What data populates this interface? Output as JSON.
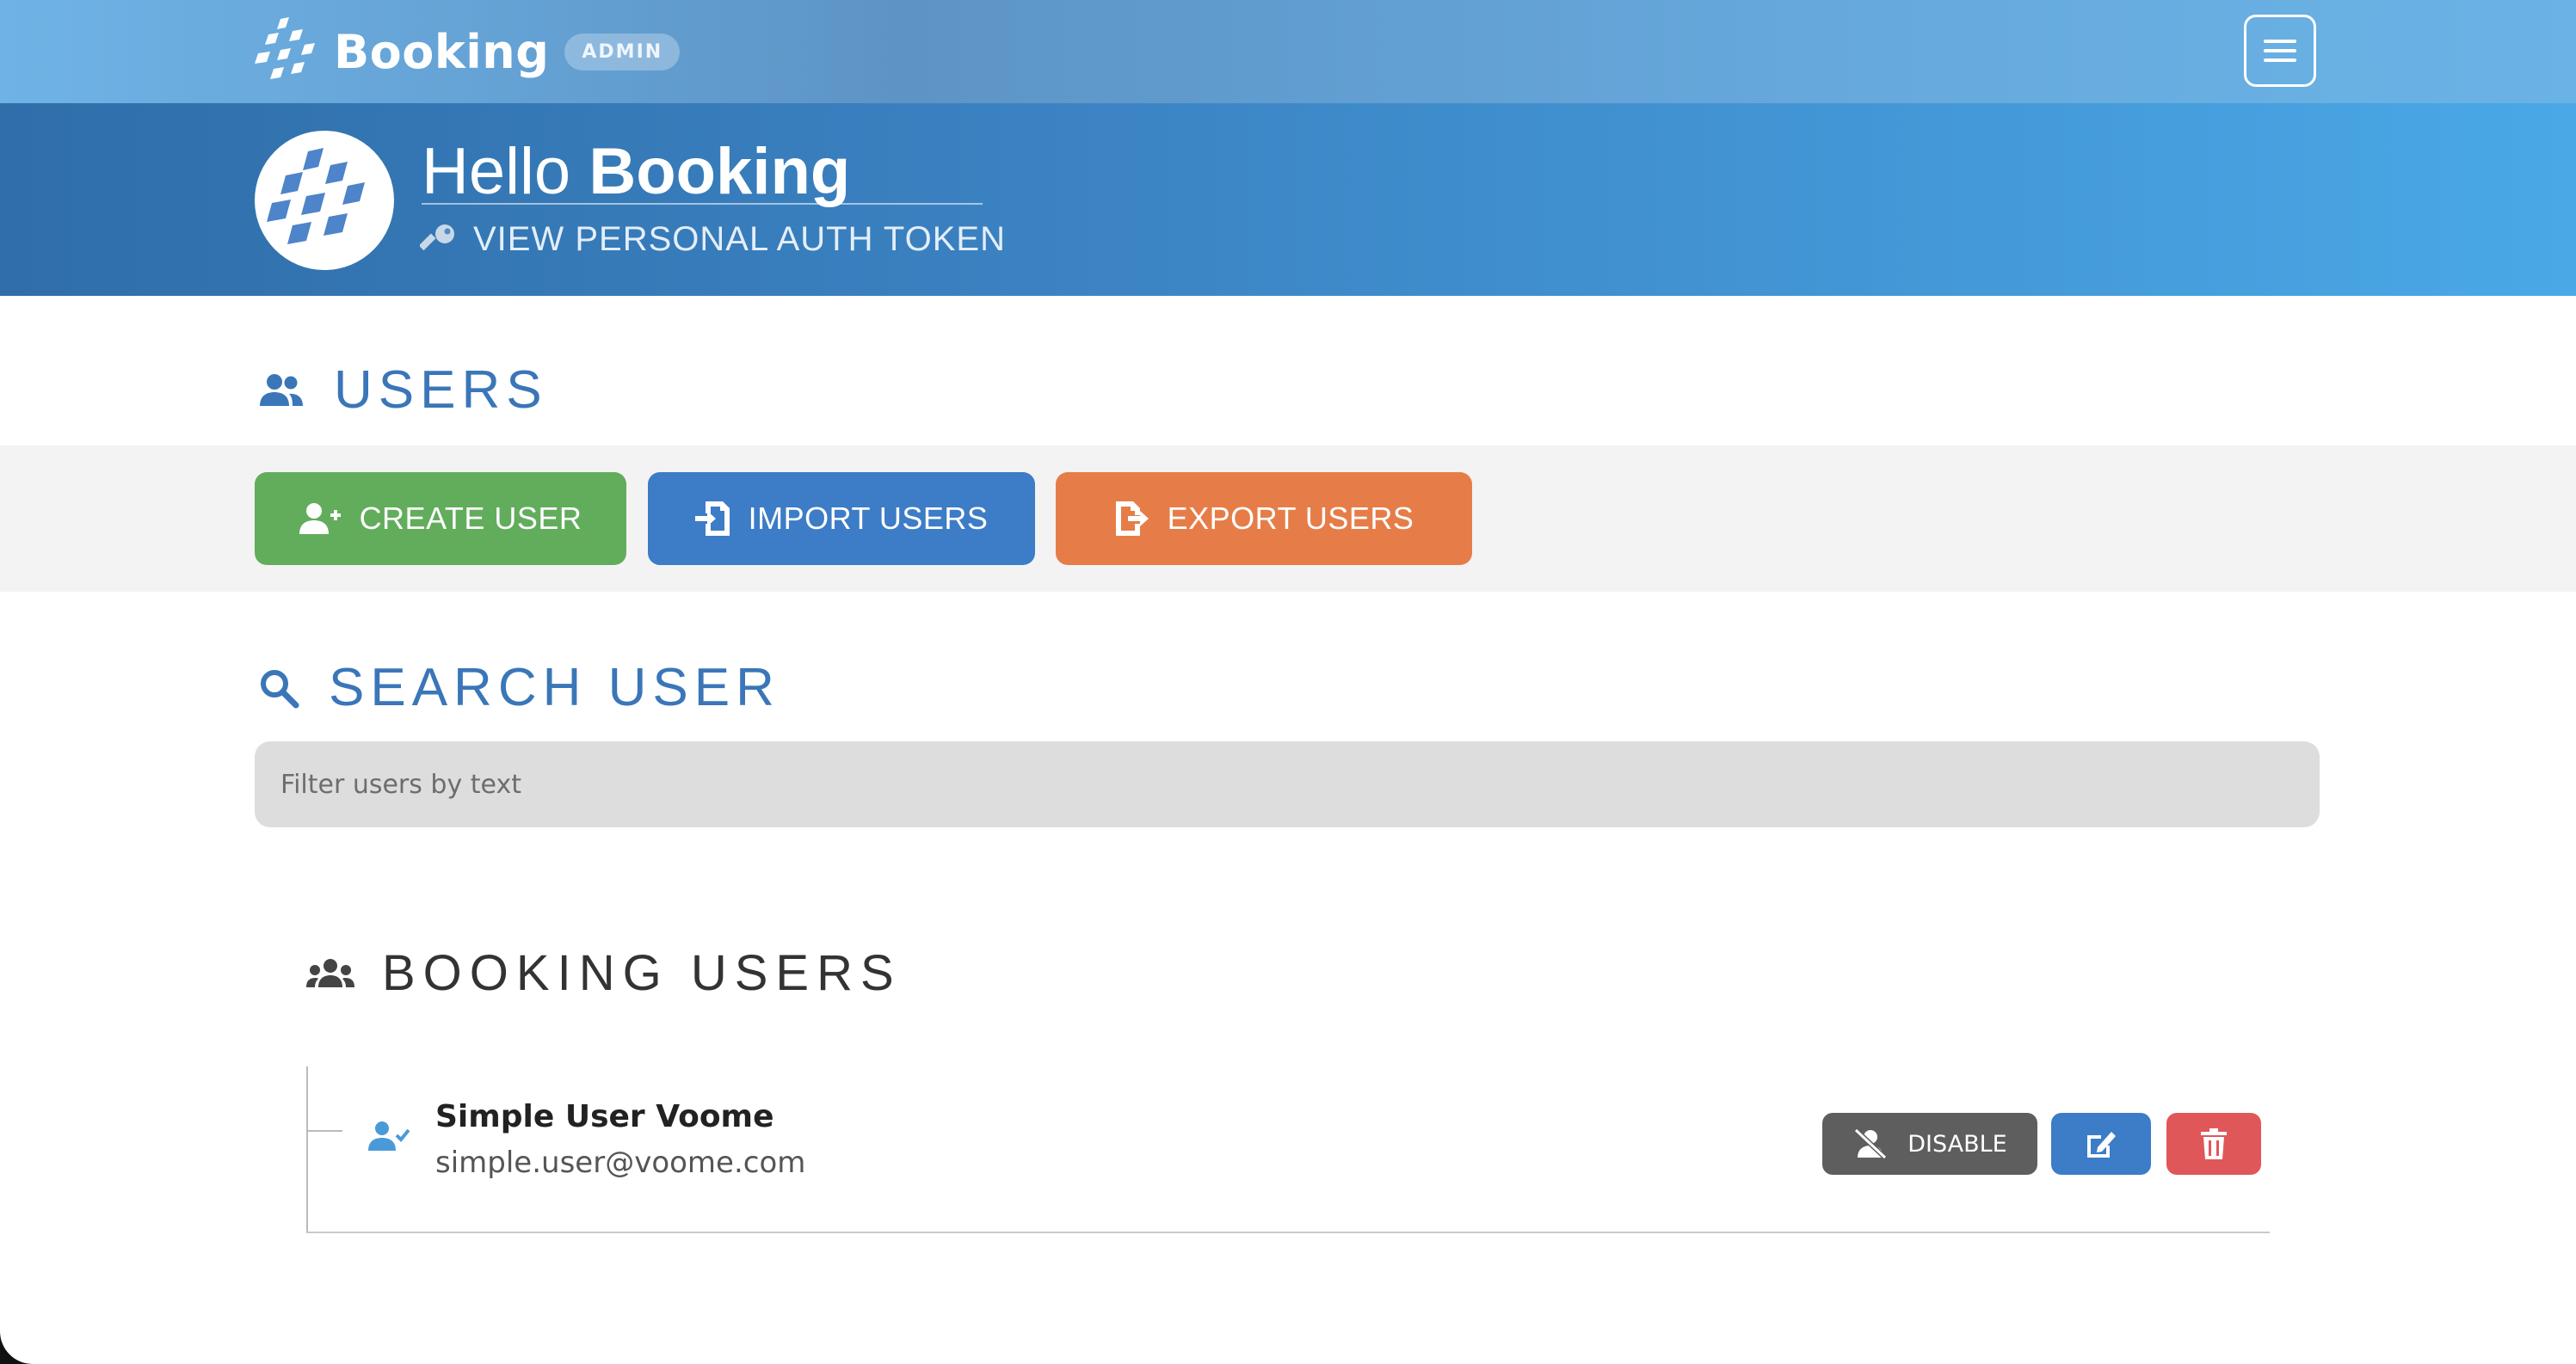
{
  "app": {
    "brand_name": "Booking",
    "badge": "ADMIN"
  },
  "header": {
    "greeting": "Hello",
    "user_name": "Booking",
    "auth_token_link": "VIEW PERSONAL AUTH TOKEN"
  },
  "users_section": {
    "title": "USERS",
    "actions": {
      "create_label": "CREATE USER",
      "import_label": "IMPORT USERS",
      "export_label": "EXPORT USERS"
    }
  },
  "search": {
    "title": "SEARCH USER",
    "placeholder": "Filter users by text",
    "value": ""
  },
  "user_list": {
    "title": "BOOKING USERS",
    "users": [
      {
        "name": "Simple User Voome",
        "email": "simple.user@voome.com",
        "disable_label": "DISABLE"
      }
    ]
  },
  "colors": {
    "accent": "#3a76b8",
    "create": "#62ad5c",
    "import": "#3d7cc6",
    "export": "#e67d48",
    "disable": "#5e5e5e",
    "delete": "#e0575a"
  }
}
